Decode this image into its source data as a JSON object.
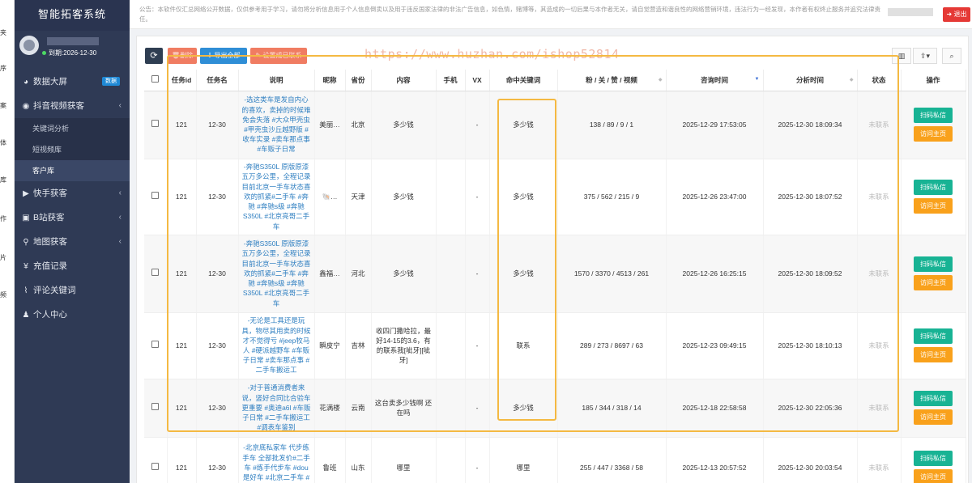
{
  "edge_labels": [
    "夹",
    "序",
    "案",
    "体",
    "库",
    "作",
    "片",
    "频"
  ],
  "brand": "智能拓客系统",
  "user": {
    "expire": "到期:2026-12-30"
  },
  "nav": {
    "data_dashboard": {
      "label": "数据大屏",
      "badge": "数据"
    },
    "douyin": {
      "label": "抖音视频获客"
    },
    "douyin_sub": [
      "关键词分析",
      "短视频库",
      "客户库"
    ],
    "kuaishou": {
      "label": "快手获客"
    },
    "bilibili": {
      "label": "B站获客"
    },
    "map": {
      "label": "地图获客"
    },
    "recharge": {
      "label": "充值记录"
    },
    "comment_kw": {
      "label": "评论关键词"
    },
    "profile": {
      "label": "个人中心"
    }
  },
  "notice": {
    "text": "公告：本软件仅汇总网络公开数据，仅供参考用于学习，请勿将分析信息用于个人信息倒卖以及用于违反国家法律的非法广告信息，如色情，赌博等，其造成的一切后果与本作者无关，请自觉营造和谐良性的网络营销环境，违法行为一经发现，本作者有权终止服务并追究法律责任。",
    "exit_label": "退出"
  },
  "toolbar": {
    "refresh_icon": "⟳",
    "delete_label": "删除",
    "export_label": "导出全部",
    "mark_label": "设置成已联系"
  },
  "right_tools": [
    "▥",
    "⇪▾",
    "⌕"
  ],
  "watermark": "https://www.huzhan.com/ishop52814",
  "table": {
    "headers": [
      "",
      "任务id",
      "任务名",
      "说明",
      "昵称",
      "省份",
      "内容",
      "手机",
      "VX",
      "命中关键词",
      "粉 / 关 / 赞 / 视频",
      "咨询时间",
      "分析时间",
      "状态",
      "操作"
    ],
    "action_scan": "扫码私信",
    "action_visit": "访问主页",
    "rows": [
      {
        "id": "121",
        "task": "12-30",
        "desc": "-选这类车是发自内心的喜欢，卖掉的时候难免会失落 #大众甲壳虫 #甲壳虫沙丘越野版 #收车实录 #卖车那点事 #车贩子日常",
        "nick": "美丽…",
        "province": "北京",
        "content": "多少钱",
        "phone": "",
        "vx": "-",
        "keyword": "多少钱",
        "stats": "138 / 89 / 9 / 1",
        "consult": "2025-12-29 17:53:05",
        "analyze": "2025-12-30 18:09:34",
        "status": "未联系"
      },
      {
        "id": "121",
        "task": "12-30",
        "desc": "-奔驰S350L 原版原漆五万多公里，全程记录目前北京一手车状态喜欢的抓紧#二手车 #奔驰 #奔驰s级 #奔驰S350L #北京亮哥二手车",
        "nick": "🐚…",
        "province": "天津",
        "content": "多少钱",
        "phone": "",
        "vx": "-",
        "keyword": "多少钱",
        "stats": "375 / 562 / 215 / 9",
        "consult": "2025-12-26 23:47:00",
        "analyze": "2025-12-30 18:07:52",
        "status": "未联系"
      },
      {
        "id": "121",
        "task": "12-30",
        "desc": "-奔驰S350L 原版原漆五万多公里，全程记录目前北京一手车状态喜欢的抓紧#二手车 #奔驰 #奔驰s级 #奔驰S350L #北京亮哥二手车",
        "nick": "鑫福…",
        "province": "河北",
        "content": "多少钱",
        "phone": "",
        "vx": "-",
        "keyword": "多少钱",
        "stats": "1570 / 3370 / 4513 / 261",
        "consult": "2025-12-26 16:25:15",
        "analyze": "2025-12-30 18:09:52",
        "status": "未联系"
      },
      {
        "id": "121",
        "task": "12-30",
        "desc": "-无论是工具还是玩具，物尽其用卖的时候才不觉得亏 #jeep牧马人 #硬派越野车 #车贩子日常 #卖车那点事 #二手车搬运工",
        "nick": "瞬皮宁",
        "province": "吉林",
        "content": "收四门撒哈拉，最好14-15的3.6，有的联系我[呲牙][呲牙]",
        "phone": "",
        "vx": "-",
        "keyword": "联系",
        "stats": "289 / 273 / 8697 / 63",
        "consult": "2025-12-23 09:49:15",
        "analyze": "2025-12-30 18:10:13",
        "status": "未联系"
      },
      {
        "id": "121",
        "task": "12-30",
        "desc": "-对于普通消费者来说，竖好合同比合验车更重要 #奥迪a6l #车贩子日常 #二手车搬运工 #调表车鉴别",
        "nick": "花满楼",
        "province": "云南",
        "content": "这台卖多少钱啊 还在吗",
        "phone": "",
        "vx": "-",
        "keyword": "多少钱",
        "stats": "185 / 344 / 318 / 14",
        "consult": "2025-12-18 22:58:58",
        "analyze": "2025-12-30 22:05:36",
        "status": "未联系"
      },
      {
        "id": "121",
        "task": "12-30",
        "desc": "-北京底私家车 代步练手车 全部批发价#二手车 #练手代步车 #dou是好车 #北京二手车 #车况极品 代目首付",
        "nick": "鲁班",
        "province": "山东",
        "content": "哪里",
        "phone": "",
        "vx": "-",
        "keyword": "哪里",
        "stats": "255 / 447 / 3368 / 58",
        "consult": "2025-12-13 20:57:52",
        "analyze": "2025-12-30 20:03:54",
        "status": "未联系"
      }
    ]
  }
}
